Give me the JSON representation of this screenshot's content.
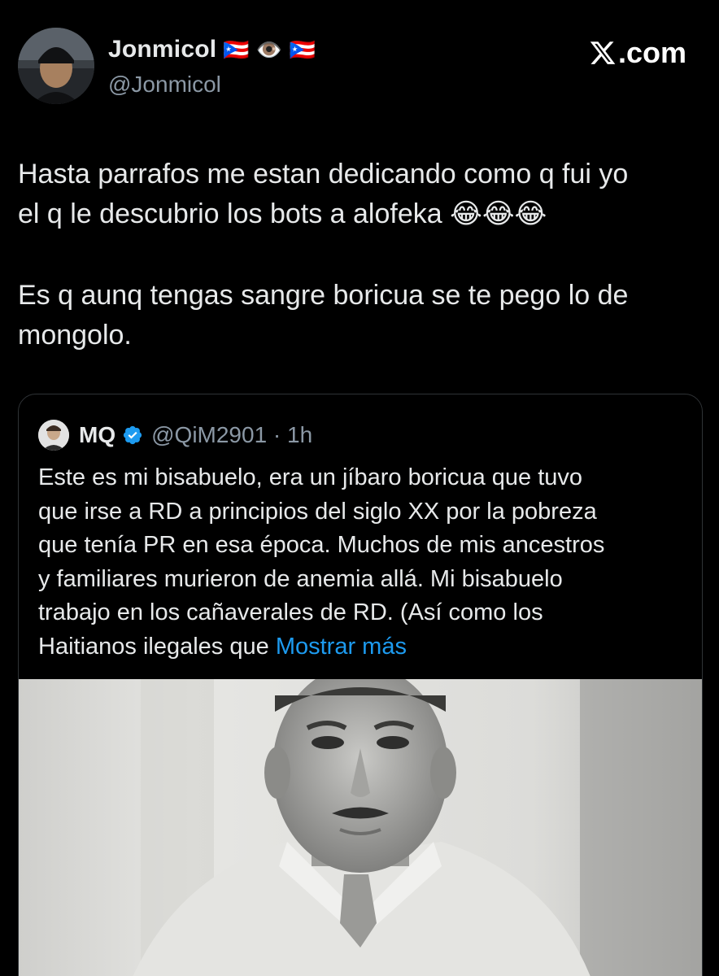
{
  "author": {
    "display_name": "Jonmicol",
    "flag_emojis": [
      "🇵🇷",
      "👁️",
      "🇵🇷"
    ],
    "handle": "@Jonmicol"
  },
  "brand": {
    "label": ".com",
    "icon": "x-logo-icon"
  },
  "tweet": {
    "lines": [
      "Hasta parrafos me estan dedicando como q fui yo",
      "el q le descubrio los bots a alofeka 😂😂😂",
      "Es q aunq tengas sangre boricua se te pego lo de",
      "mongolo."
    ]
  },
  "quote": {
    "name": "MQ",
    "verified": true,
    "handle_time": "@QiM2901 · 1h",
    "lines": [
      "Este es mi bisabuelo, era un jíbaro boricua que tuvo",
      "que irse a RD a principios del siglo XX por la pobreza",
      "que tenía PR en esa época. Muchos de mis ancestros",
      "y familiares murieron de anemia allá. Mi bisabuelo",
      "trabajo en los cañaverales de RD. (Así como los",
      "Haitianos ilegales que"
    ],
    "show_more": "Mostrar más"
  },
  "colors": {
    "background": "#000000",
    "text": "#e7e9ea",
    "muted": "#8b98a5",
    "link": "#1d9bf0",
    "border": "#2f3336"
  }
}
